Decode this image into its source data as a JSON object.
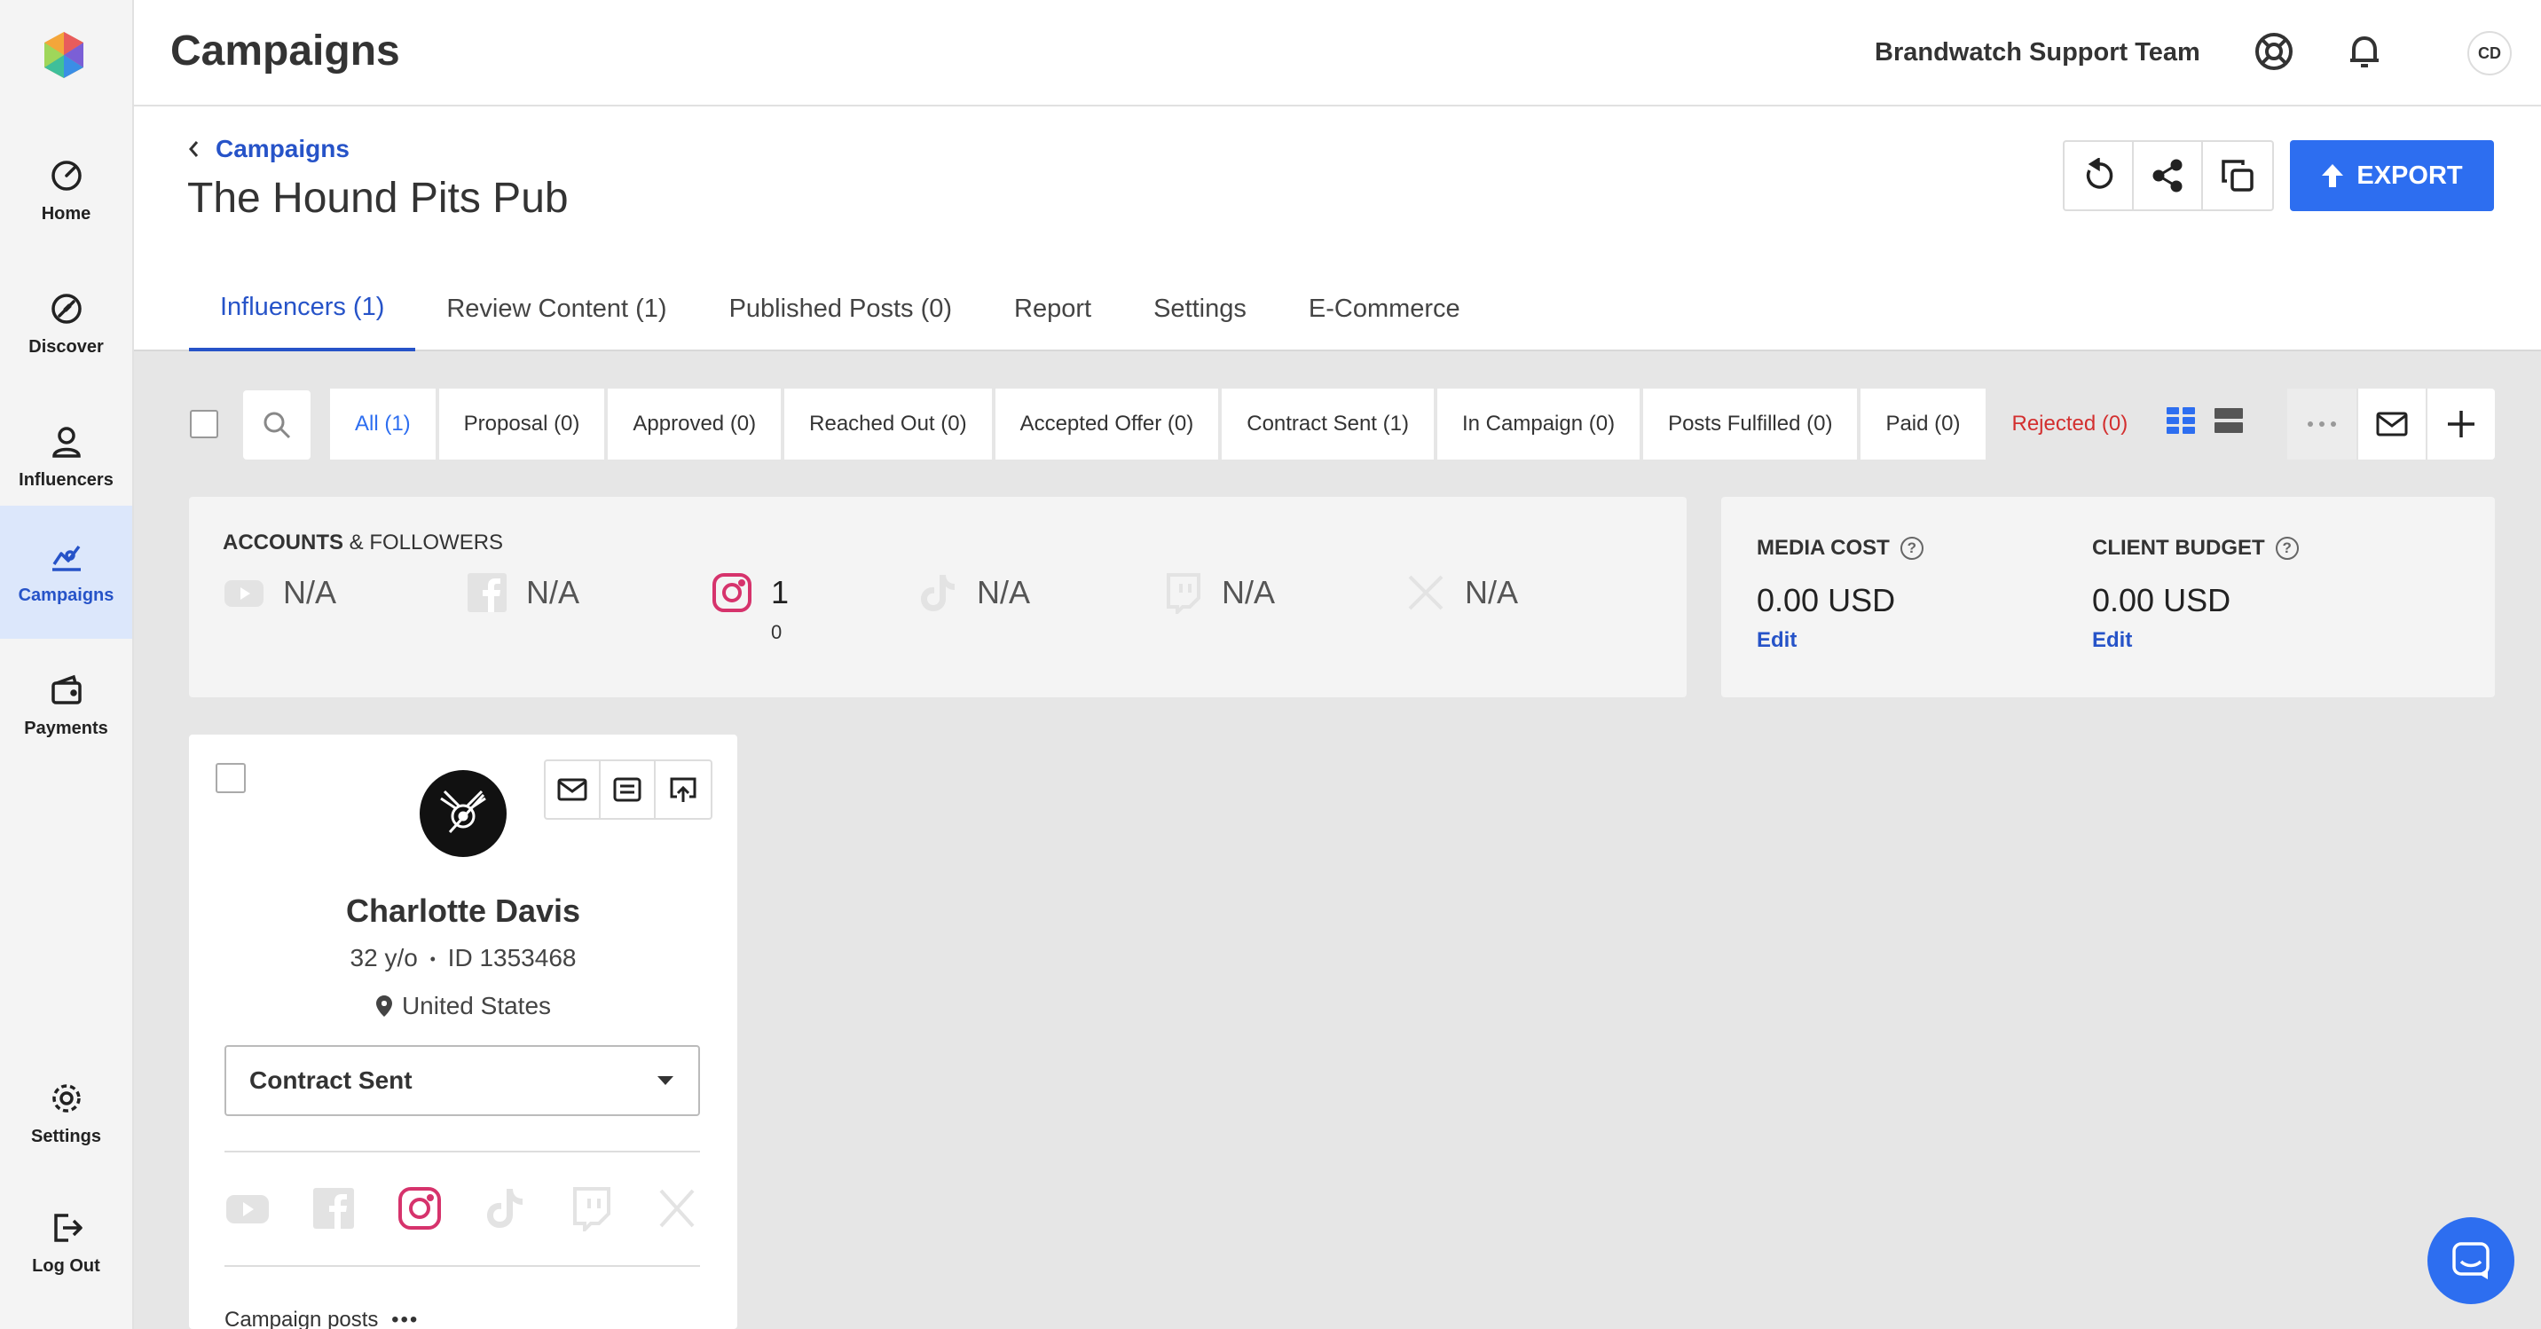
{
  "sidebar": {
    "items": [
      {
        "label": "Home",
        "icon": "home-gauge-icon"
      },
      {
        "label": "Discover",
        "icon": "discover-icon"
      },
      {
        "label": "Influencers",
        "icon": "person-icon"
      },
      {
        "label": "Campaigns",
        "icon": "campaigns-icon",
        "active": true
      },
      {
        "label": "Payments",
        "icon": "wallet-icon"
      },
      {
        "label": "Settings",
        "icon": "gear-icon"
      },
      {
        "label": "Log Out",
        "icon": "logout-icon"
      }
    ]
  },
  "header": {
    "title": "Campaigns",
    "team_name": "Brandwatch Support Team",
    "user_initials": "CD"
  },
  "subheader": {
    "breadcrumb": "Campaigns",
    "page_title": "The Hound Pits Pub",
    "export_label": "EXPORT",
    "tabs": [
      {
        "label": "Influencers (1)",
        "active": true
      },
      {
        "label": "Review Content (1)"
      },
      {
        "label": "Published Posts (0)"
      },
      {
        "label": "Report"
      },
      {
        "label": "Settings"
      },
      {
        "label": "E-Commerce"
      }
    ]
  },
  "filters": {
    "stages": [
      {
        "label": "All (1)",
        "active": true
      },
      {
        "label": "Proposal (0)"
      },
      {
        "label": "Approved (0)"
      },
      {
        "label": "Reached Out (0)"
      },
      {
        "label": "Accepted Offer (0)"
      },
      {
        "label": "Contract Sent (1)"
      },
      {
        "label": "In Campaign (0)"
      },
      {
        "label": "Posts Fulfilled (0)"
      },
      {
        "label": "Paid (0)"
      },
      {
        "label": "Rejected (0)",
        "rejected": true
      }
    ]
  },
  "accounts": {
    "heading_bold": "ACCOUNTS",
    "heading_rest": " & FOLLOWERS",
    "items": [
      {
        "platform": "youtube-icon",
        "value": "N/A"
      },
      {
        "platform": "facebook-icon",
        "value": "N/A"
      },
      {
        "platform": "instagram-icon",
        "value": "1",
        "sub": "0"
      },
      {
        "platform": "tiktok-icon",
        "value": "N/A"
      },
      {
        "platform": "twitch-icon",
        "value": "N/A"
      },
      {
        "platform": "x-icon",
        "value": "N/A"
      }
    ]
  },
  "budget": {
    "media_cost_label": "MEDIA COST",
    "media_cost_value": "0.00 USD",
    "client_budget_label": "CLIENT BUDGET",
    "client_budget_value": "0.00 USD",
    "edit_label": "Edit",
    "help_glyph": "?"
  },
  "influencer_card": {
    "name": "Charlotte Davis",
    "age": "32 y/o",
    "separator": "•",
    "id": "ID 1353468",
    "location": "United States",
    "status": "Contract Sent",
    "campaign_posts_label": "Campaign posts",
    "campaign_posts_dots": "•••"
  },
  "colors": {
    "accent": "#2d6ef0",
    "link": "#2653c8",
    "rejected": "#d32f2f",
    "instagram": "#d6336c"
  }
}
